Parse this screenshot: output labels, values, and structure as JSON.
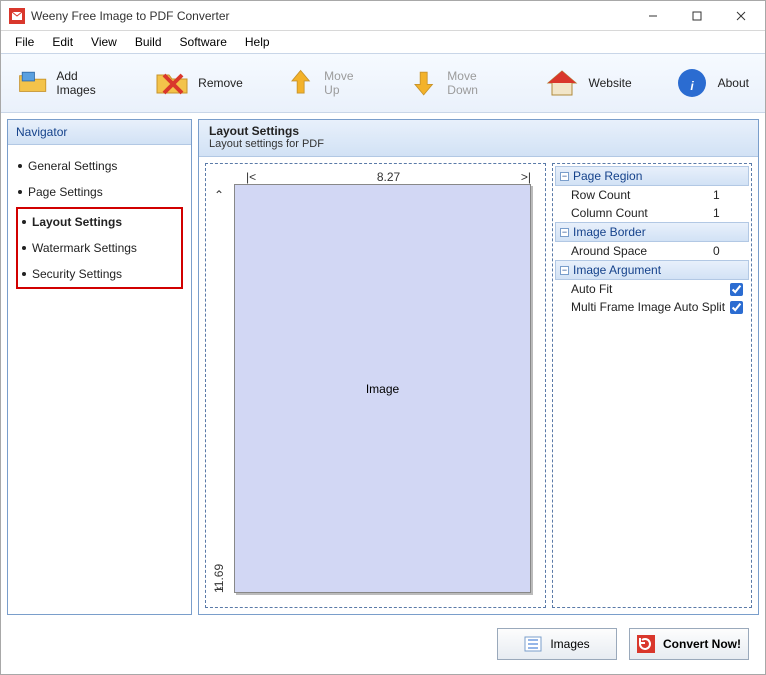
{
  "window": {
    "title": "Weeny Free Image to PDF Converter"
  },
  "menu": {
    "file": "File",
    "edit": "Edit",
    "view": "View",
    "build": "Build",
    "software": "Software",
    "help": "Help"
  },
  "toolbar": {
    "add": "Add Images",
    "remove": "Remove",
    "moveup": "Move Up",
    "movedown": "Move Down",
    "website": "Website",
    "about": "About"
  },
  "navigator": {
    "header": "Navigator",
    "items": [
      {
        "label": "General Settings"
      },
      {
        "label": "Page Settings"
      },
      {
        "label": "Layout Settings",
        "current": true
      },
      {
        "label": "Watermark Settings"
      },
      {
        "label": "Security Settings"
      }
    ]
  },
  "content": {
    "title": "Layout Settings",
    "subtitle": "Layout settings for PDF",
    "page_width": "8.27",
    "page_height": "11.69",
    "cell_label": "Image"
  },
  "props": {
    "g1": "Page Region",
    "row_count_label": "Row Count",
    "row_count_value": "1",
    "col_count_label": "Column Count",
    "col_count_value": "1",
    "g2": "Image Border",
    "around_label": "Around Space",
    "around_value": "0",
    "g3": "Image Argument",
    "autofit_label": "Auto Fit",
    "multisplit_label": "Multi Frame Image Auto Split"
  },
  "bottom": {
    "images": "Images",
    "convert": "Convert Now!"
  }
}
